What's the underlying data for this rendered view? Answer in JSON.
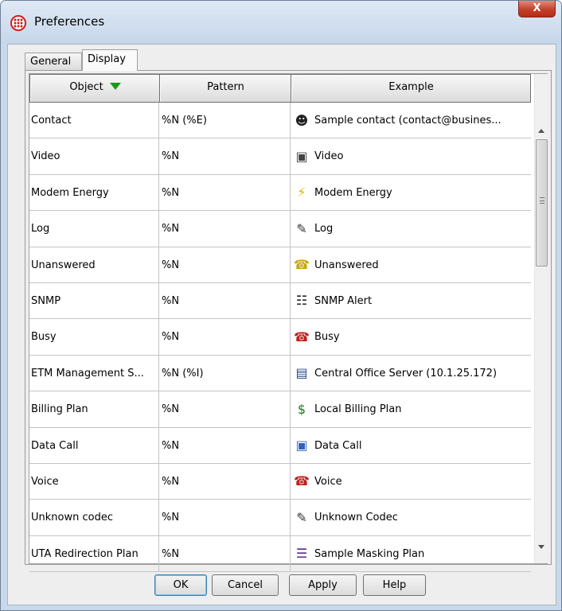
{
  "window": {
    "title": "Preferences",
    "close_glyph": "X"
  },
  "tabs": [
    {
      "label": "General",
      "selected": false
    },
    {
      "label": "Display",
      "selected": true
    }
  ],
  "table": {
    "columns": [
      {
        "label": "Object",
        "sorted": "descending"
      },
      {
        "label": "Pattern"
      },
      {
        "label": "Example"
      }
    ],
    "rows": [
      {
        "object": "Contact",
        "pattern": "%N (%E)",
        "example": "Sample contact (contact@busines...",
        "icon": "contact-icon"
      },
      {
        "object": "Video",
        "pattern": "%N",
        "example": "Video",
        "icon": "video-icon"
      },
      {
        "object": "Modem Energy",
        "pattern": "%N",
        "example": "Modem Energy",
        "icon": "modem-energy-icon"
      },
      {
        "object": "Log",
        "pattern": "%N",
        "example": "Log",
        "icon": "log-icon"
      },
      {
        "object": "Unanswered",
        "pattern": "%N",
        "example": "Unanswered",
        "icon": "unanswered-phone-icon"
      },
      {
        "object": "SNMP",
        "pattern": "%N",
        "example": "SNMP Alert",
        "icon": "snmp-network-icon"
      },
      {
        "object": "Busy",
        "pattern": "%N",
        "example": "Busy",
        "icon": "busy-phone-icon"
      },
      {
        "object": "ETM Management S...",
        "pattern": "%N (%I)",
        "example": "Central Office Server (10.1.25.172)",
        "icon": "server-icon"
      },
      {
        "object": "Billing Plan",
        "pattern": "%N",
        "example": "Local Billing Plan",
        "icon": "billing-plan-icon"
      },
      {
        "object": "Data Call",
        "pattern": "%N",
        "example": "Data Call",
        "icon": "data-call-icon"
      },
      {
        "object": "Voice",
        "pattern": "%N",
        "example": "Voice",
        "icon": "voice-phone-icon"
      },
      {
        "object": "Unknown codec",
        "pattern": "%N",
        "example": "Unknown Codec",
        "icon": "codec-icon"
      },
      {
        "object": "UTA Redirection Plan",
        "pattern": "%N",
        "example": "Sample Masking Plan",
        "icon": "masking-plan-icon"
      }
    ]
  },
  "buttons": {
    "ok": "OK",
    "cancel": "Cancel",
    "apply": "Apply",
    "help": "Help"
  },
  "colors": {
    "sort_arrow": "#1a9a1a",
    "close_button": "#c4402a",
    "app_icon": "#cc1f1f"
  }
}
